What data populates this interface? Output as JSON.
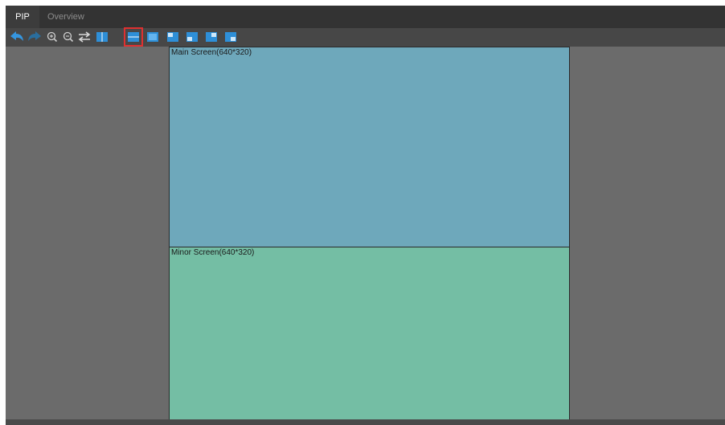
{
  "tabs": [
    {
      "label": "PIP",
      "active": true
    },
    {
      "label": "Overview",
      "active": false
    }
  ],
  "toolbar": {
    "icons": [
      "undo-icon",
      "redo-icon",
      "zoom-in-icon",
      "zoom-out-icon",
      "swap-icon",
      "layout-side-by-side-icon",
      "layout-top-bottom-icon",
      "layout-single-icon",
      "layout-pip-top-left-icon",
      "layout-pip-bottom-left-icon",
      "layout-pip-top-right-icon",
      "layout-pip-bottom-right-icon"
    ],
    "selected": "layout-top-bottom-icon"
  },
  "screens": {
    "main": {
      "label": "Main Screen(640*320)",
      "color": "#6ea8bb"
    },
    "minor": {
      "label": "Minor Screen(640*320)",
      "color": "#74bea4"
    }
  },
  "colors": {
    "icon": "#2e8fd8",
    "selection": "#e03030",
    "canvas": "#6b6b6b"
  }
}
